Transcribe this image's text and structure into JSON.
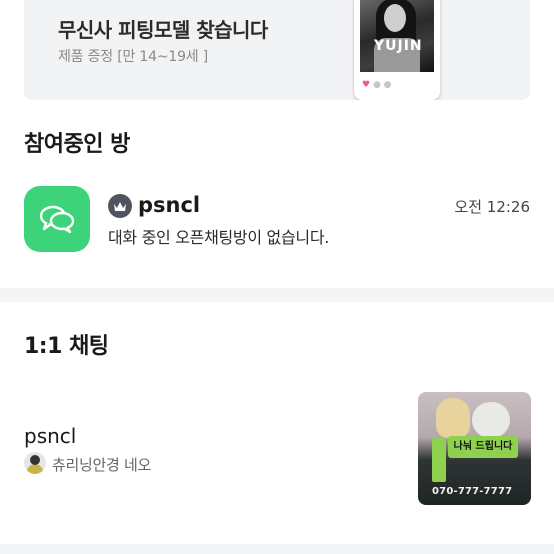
{
  "banner": {
    "title": "무신사 피팅모델 찾습니다",
    "subtitle": "제품 증정 [만 14~19세 ]",
    "image_text": "YUJIN"
  },
  "open_chat": {
    "section_title": "참여중인 방",
    "room": {
      "icon": "chat-bubbles-icon",
      "badge_icon": "crown-icon",
      "name": "psncl",
      "time": "오전 12:26",
      "description": "대화 중인 오픈채팅방이 없습니다."
    }
  },
  "direct_chat": {
    "section_title": "1:1 채팅",
    "item": {
      "name": "psncl",
      "subtitle": "츄리닝안경 네오",
      "thumbnail_label": "나눠 드립니다",
      "thumbnail_phone": "070-777-7777"
    }
  },
  "colors": {
    "accent_green": "#3dd37a",
    "divider": "#f4f5f7",
    "banner_bg": "#f2f3f5"
  }
}
